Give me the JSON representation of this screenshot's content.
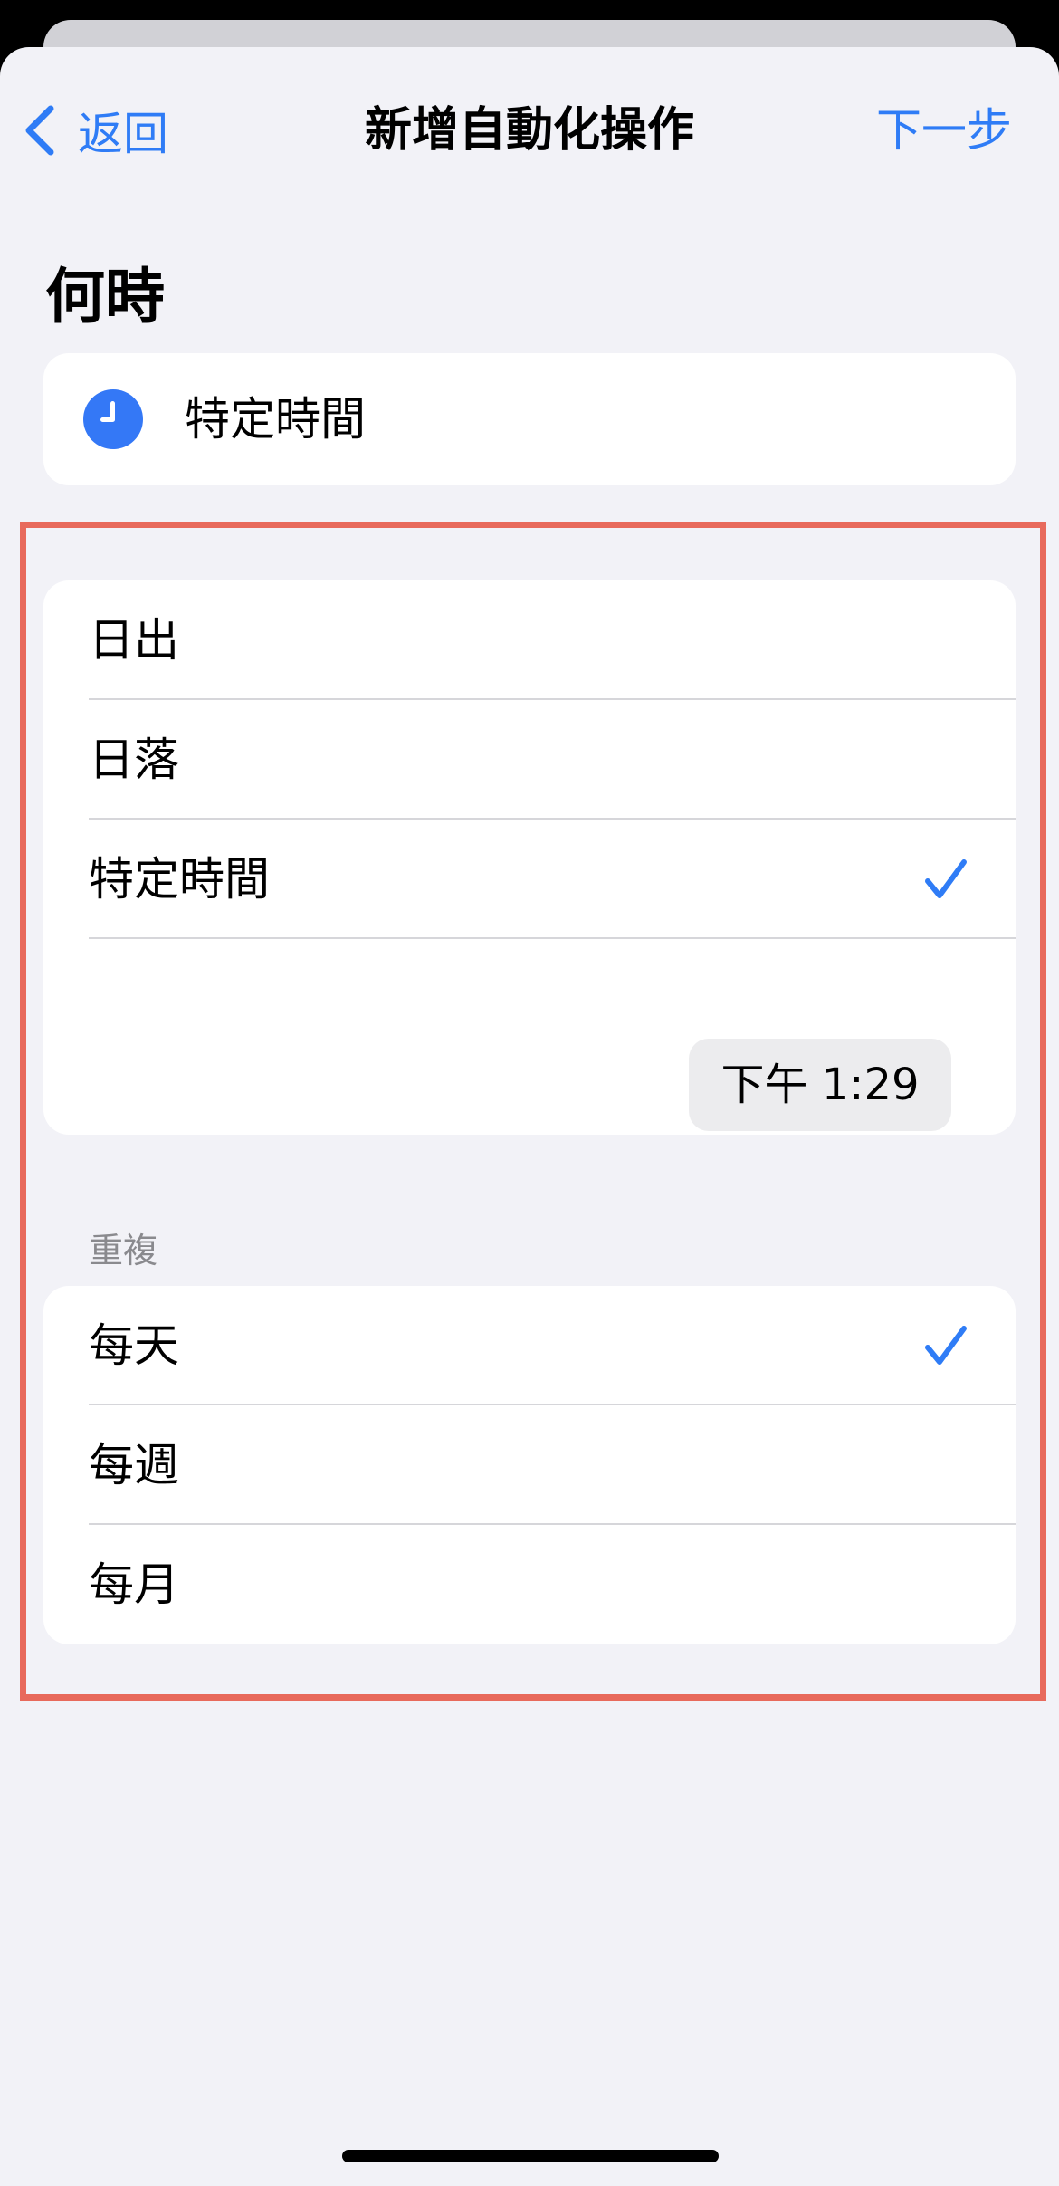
{
  "navbar": {
    "back_label": "返回",
    "title": "新增自動化操作",
    "next_label": "下一步"
  },
  "when": {
    "heading": "何時",
    "summary": "特定時間",
    "options": [
      {
        "label": "日出",
        "selected": false
      },
      {
        "label": "日落",
        "selected": false
      },
      {
        "label": "特定時間",
        "selected": true
      }
    ],
    "time": "下午 1:29"
  },
  "repeat": {
    "header": "重複",
    "options": [
      {
        "label": "每天",
        "selected": true
      },
      {
        "label": "每週",
        "selected": false
      },
      {
        "label": "每月",
        "selected": false
      }
    ]
  },
  "colors": {
    "accent": "#2f7cf6",
    "highlight": "#e86a5c",
    "background": "#f2f2f7"
  }
}
